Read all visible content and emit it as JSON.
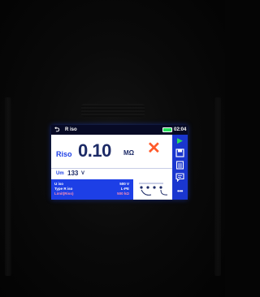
{
  "screen": {
    "title": "R iso",
    "clock": "02:04",
    "result": {
      "label": "Riso",
      "value": "0.10",
      "unit": "MΩ"
    },
    "measured_voltage": {
      "label": "Um",
      "value": "133",
      "unit": "V"
    },
    "params": [
      {
        "key": "U iso",
        "value": "500 V"
      },
      {
        "key": "Type R iso",
        "value": "L-PE"
      },
      {
        "key": "Limit(Riso)",
        "value": "500 kΩ"
      }
    ],
    "status_icons": {
      "back": "back-arrow-icon",
      "battery": "battery-icon",
      "fail": "cross-icon"
    },
    "sidebar_icons": [
      "play-icon",
      "save-icon",
      "list-icon",
      "comment-icon",
      "more-icon"
    ],
    "colors": {
      "screen_blue": "#1d3fe6",
      "fail_red": "#ff5a2a",
      "limit_pink": "#ff8fb4",
      "battery_green": "#25e05a"
    }
  }
}
